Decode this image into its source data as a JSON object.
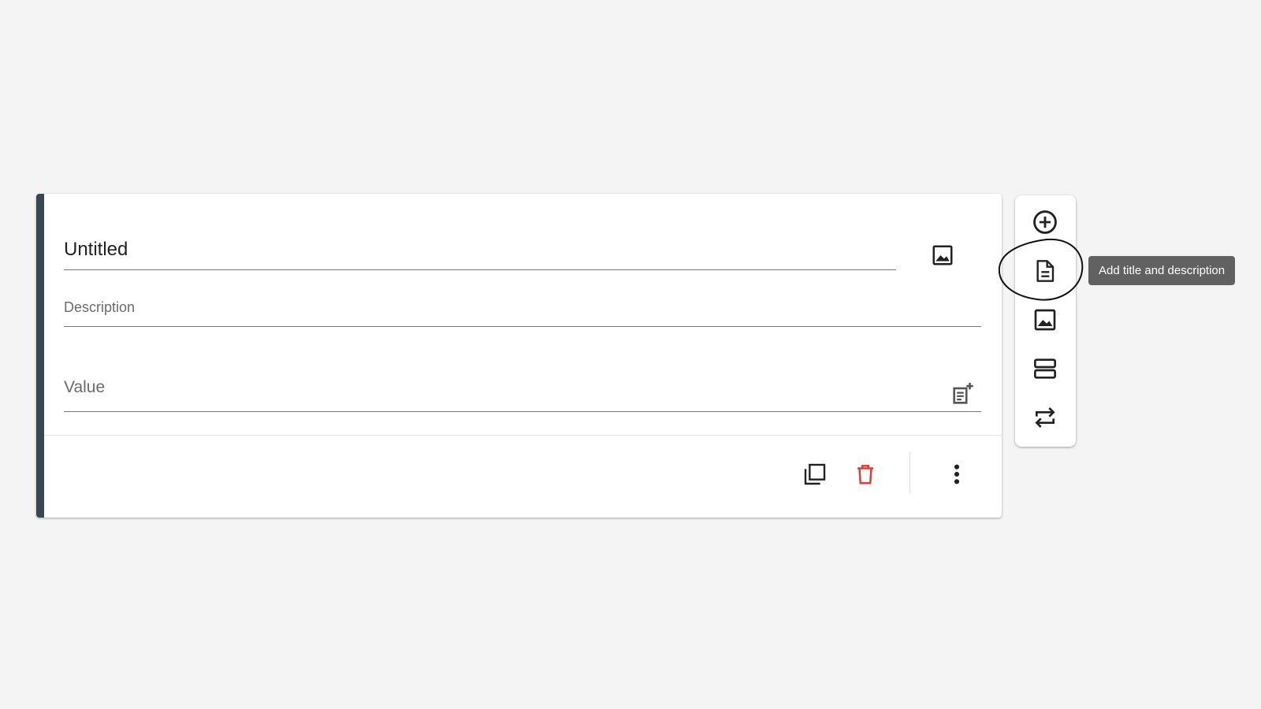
{
  "colors": {
    "accent": "#37474f",
    "delete": "#e53935",
    "tooltip_bg": "#616161",
    "icon": "#222222"
  },
  "card": {
    "title_value": "Untitled",
    "description_placeholder": "Description",
    "value_placeholder": "Value",
    "icons": {
      "title_image": "image-icon",
      "value_add": "add-note-icon",
      "copy": "copy-icon",
      "delete": "trash-icon",
      "more": "more-vertical-icon"
    }
  },
  "toolbar": {
    "items": [
      {
        "icon": "add-circle-icon",
        "action": "add question"
      },
      {
        "icon": "document-icon",
        "action": "add title and description"
      },
      {
        "icon": "image-icon",
        "action": "add image"
      },
      {
        "icon": "section-icon",
        "action": "add section"
      },
      {
        "icon": "swap-icon",
        "action": "import"
      }
    ]
  },
  "tooltip": {
    "text": "Add title and description"
  }
}
